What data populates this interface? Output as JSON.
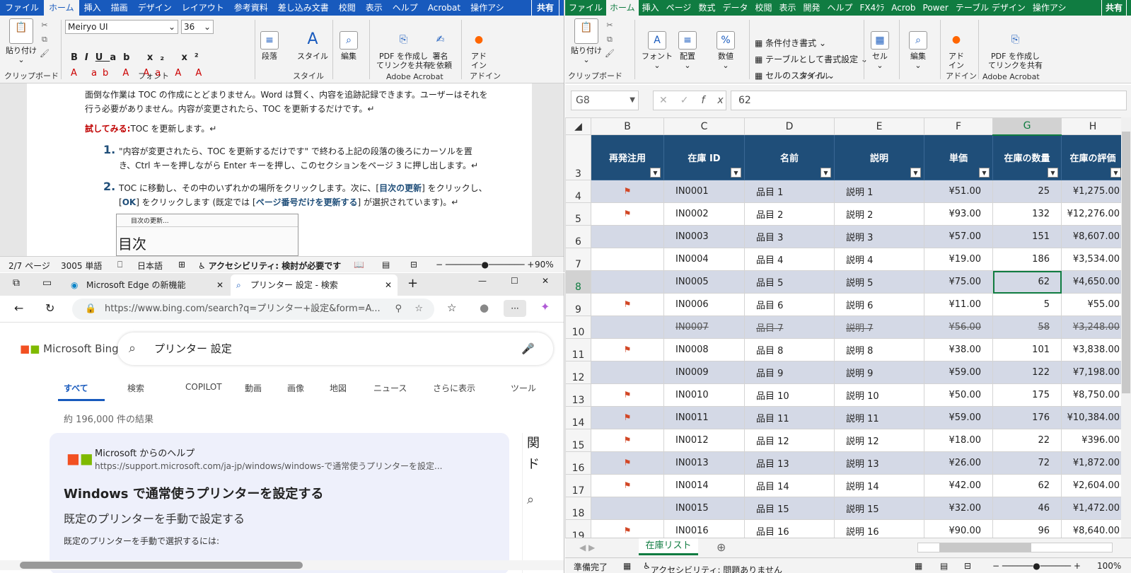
{
  "word": {
    "tabs": [
      "ファイル",
      "ホーム",
      "挿入",
      "描画",
      "デザイン",
      "レイアウト",
      "参考資料",
      "差し込み文書",
      "校閲",
      "表示",
      "ヘルプ",
      "Acrobat",
      "操作アシ"
    ],
    "share": "共有",
    "font_name": "Meiryo UI",
    "font_size": "36",
    "ribbon": {
      "paste": "貼り付け",
      "clipboard": "クリップボード",
      "font": "フォント",
      "paragraph": "段落",
      "style": "スタイル",
      "edit": "編集",
      "pdf_link": "PDF を作成し",
      "pdf_link2": "てリンクを共有",
      "sign": "署名",
      "sign2": "を依頼",
      "addin": "アド",
      "addin2": "イン",
      "acrobat": "Adobe Acrobat",
      "addins": "アドイン",
      "style_group": "スタイル"
    },
    "doc": {
      "para1a": "面倒な作業は TOC の作成にとどまりません。Word は賢く、内容を追跡記録できます。ユーザーはそれを",
      "para1b": "行う必要がありません。内容が変更されたら、TOC を更新するだけです。↵",
      "try_label": "試してみる:",
      "try_text": "TOC を更新します。↵",
      "step1_num": "1.",
      "step1a": "\"内容が変更されたら、TOC を更新するだけです\" で終わる上記の段落の後ろにカーソルを置",
      "step1b": "き、Ctrl キーを押しながら Enter キーを押し、このセクションをページ 3 に押し出します。↵",
      "step2_num": "2.",
      "step2a_pre": "TOC に移動し、その中のいずれかの場所をクリックします。次に、[",
      "step2a_link": "目次の更新",
      "step2a_post": "] をクリックし、",
      "step2b_pre": "[",
      "step2b_ok": "OK",
      "step2b_mid": "] をクリックします (既定では [",
      "step2b_link": "ページ番号だけを更新する",
      "step2b_post": "] が選択されています)。↵",
      "thumb_label": "目次の更新...",
      "thumb_big": "目次"
    },
    "status": {
      "page": "2/7 ページ",
      "words": "3005 単語",
      "lang": "日本語",
      "access": "アクセシビリティ: 検討が必要です",
      "zoom": "90%"
    }
  },
  "edge": {
    "tab1": "Microsoft Edge の新機能",
    "tab2": "プリンター 設定 - 検索",
    "url": "https://www.bing.com/search?q=プリンター+設定&form=A...",
    "bing_logo": "Microsoft Bing",
    "query": "プリンター 設定",
    "tabs": [
      "すべて",
      "検索",
      "COPILOT",
      "動画",
      "画像",
      "地図",
      "ニュース",
      "さらに表示",
      "ツール"
    ],
    "results_count": "約 196,000 件の結果",
    "card": {
      "source": "Microsoft からのヘルプ",
      "url": "https://support.microsoft.com/ja-jp/windows/windows-で通常使うプリンターを設定...",
      "title": "Windows で通常使うプリンターを設定する",
      "subtitle": "既定のプリンターを手動で設定する",
      "body": "既定のプリンターを手動で選択するには:"
    },
    "side_text1": "関",
    "side_text2": "ド"
  },
  "excel": {
    "tabs": [
      "ファイル",
      "ホーム",
      "挿入",
      "ページ",
      "数式",
      "データ",
      "校閲",
      "表示",
      "開発",
      "ヘルプ",
      "FX4ｸﾗ",
      "Acrob",
      "Power",
      "テーブル デザイン",
      "操作アシ"
    ],
    "share": "共有",
    "ribbon": {
      "paste": "貼り付け",
      "clipboard": "クリップボード",
      "font": "フォント",
      "align": "配置",
      "number": "数値",
      "cond": "条件付き書式",
      "table_fmt": "テーブルとして書式設定",
      "cell_style": "セルのスタイル",
      "style": "スタイル",
      "cell": "セル",
      "edit": "編集",
      "addin": "アド",
      "addin2": "イン",
      "addins": "アドイン",
      "pdf": "PDF を作成し",
      "pdf2": "てリンクを共有",
      "acrobat": "Adobe Acrobat"
    },
    "namebox": "G8",
    "formula": "62",
    "columns": [
      "B",
      "C",
      "D",
      "E",
      "F",
      "G",
      "H"
    ],
    "headers": [
      "再発注用",
      "在庫 ID",
      "名前",
      "説明",
      "単価",
      "在庫の数量",
      "在庫の評価"
    ],
    "header_row": "3",
    "rows": [
      {
        "n": "4",
        "flag": true,
        "id": "IN0001",
        "name": "品目 1",
        "desc": "説明 1",
        "price": "¥51.00",
        "qty": "25",
        "val": "¥1,275.00"
      },
      {
        "n": "5",
        "flag": true,
        "id": "IN0002",
        "name": "品目 2",
        "desc": "説明 2",
        "price": "¥93.00",
        "qty": "132",
        "val": "¥12,276.00"
      },
      {
        "n": "6",
        "flag": false,
        "id": "IN0003",
        "name": "品目 3",
        "desc": "説明 3",
        "price": "¥57.00",
        "qty": "151",
        "val": "¥8,607.00"
      },
      {
        "n": "7",
        "flag": false,
        "id": "IN0004",
        "name": "品目 4",
        "desc": "説明 4",
        "price": "¥19.00",
        "qty": "186",
        "val": "¥3,534.00"
      },
      {
        "n": "8",
        "flag": false,
        "id": "IN0005",
        "name": "品目 5",
        "desc": "説明 5",
        "price": "¥75.00",
        "qty": "62",
        "val": "¥4,650.00"
      },
      {
        "n": "9",
        "flag": true,
        "id": "IN0006",
        "name": "品目 6",
        "desc": "説明 6",
        "price": "¥11.00",
        "qty": "5",
        "val": "¥55.00"
      },
      {
        "n": "10",
        "flag": false,
        "id": "IN0007",
        "name": "品目 7",
        "desc": "説明 7",
        "price": "¥56.00",
        "qty": "58",
        "val": "¥3,248.00",
        "strike": true
      },
      {
        "n": "11",
        "flag": true,
        "id": "IN0008",
        "name": "品目 8",
        "desc": "説明 8",
        "price": "¥38.00",
        "qty": "101",
        "val": "¥3,838.00"
      },
      {
        "n": "12",
        "flag": false,
        "id": "IN0009",
        "name": "品目 9",
        "desc": "説明 9",
        "price": "¥59.00",
        "qty": "122",
        "val": "¥7,198.00"
      },
      {
        "n": "13",
        "flag": true,
        "id": "IN0010",
        "name": "品目 10",
        "desc": "説明 10",
        "price": "¥50.00",
        "qty": "175",
        "val": "¥8,750.00"
      },
      {
        "n": "14",
        "flag": true,
        "id": "IN0011",
        "name": "品目 11",
        "desc": "説明 11",
        "price": "¥59.00",
        "qty": "176",
        "val": "¥10,384.00"
      },
      {
        "n": "15",
        "flag": true,
        "id": "IN0012",
        "name": "品目 12",
        "desc": "説明 12",
        "price": "¥18.00",
        "qty": "22",
        "val": "¥396.00"
      },
      {
        "n": "16",
        "flag": true,
        "id": "IN0013",
        "name": "品目 13",
        "desc": "説明 13",
        "price": "¥26.00",
        "qty": "72",
        "val": "¥1,872.00"
      },
      {
        "n": "17",
        "flag": true,
        "id": "IN0014",
        "name": "品目 14",
        "desc": "説明 14",
        "price": "¥42.00",
        "qty": "62",
        "val": "¥2,604.00"
      },
      {
        "n": "18",
        "flag": false,
        "id": "IN0015",
        "name": "品目 15",
        "desc": "説明 15",
        "price": "¥32.00",
        "qty": "46",
        "val": "¥1,472.00"
      },
      {
        "n": "19",
        "flag": true,
        "id": "IN0016",
        "name": "品目 16",
        "desc": "説明 16",
        "price": "¥90.00",
        "qty": "96",
        "val": "¥8,640.00"
      }
    ],
    "sheet_tab": "在庫リスト",
    "status": {
      "ready": "準備完了",
      "access": "アクセシビリティ: 問題ありません",
      "zoom": "100%"
    }
  }
}
